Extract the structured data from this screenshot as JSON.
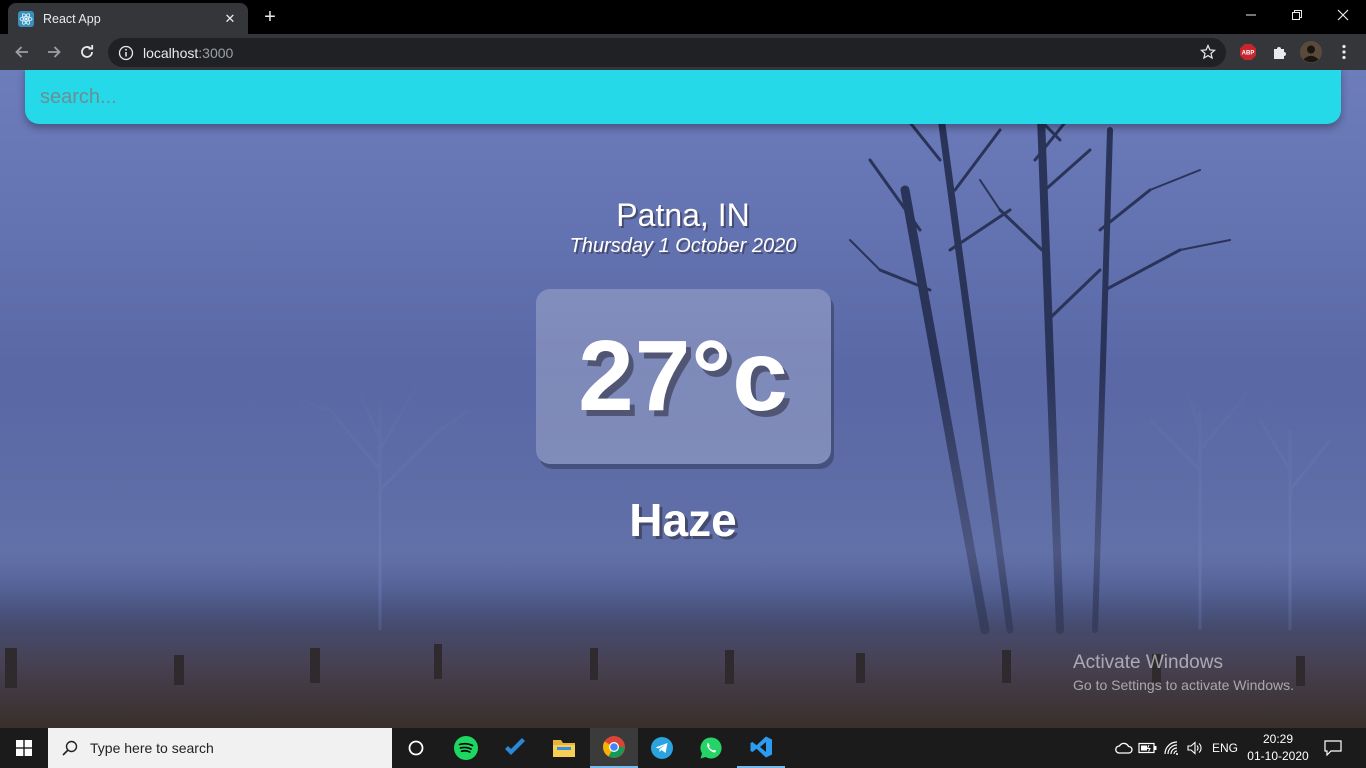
{
  "browser": {
    "tab_title": "React App",
    "tab_close": "✕",
    "new_tab": "+",
    "url_host": "localhost",
    "url_port": ":3000",
    "ext_badge": "ABP"
  },
  "app": {
    "search_placeholder": "search...",
    "location": "Patna, IN",
    "date": "Thursday 1 October 2020",
    "temperature": "27°c",
    "condition": "Haze"
  },
  "watermark": {
    "title": "Activate Windows",
    "subtitle": "Go to Settings to activate Windows."
  },
  "taskbar": {
    "search_text": "Type here to search",
    "language": "ENG",
    "time": "20:29",
    "date": "01-10-2020"
  },
  "colors": {
    "search_bar": "#25d9e8",
    "sky_top": "#6d7cbb",
    "sky_bottom": "#4b5a94",
    "chrome_tab": "#35363a"
  }
}
